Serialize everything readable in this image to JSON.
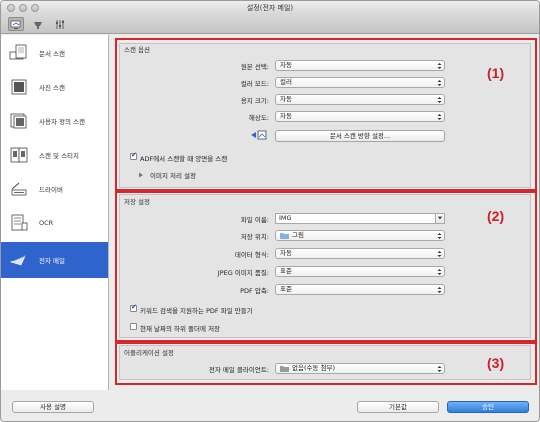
{
  "window": {
    "title": "설정(전자 메일)"
  },
  "sidebar": {
    "items": [
      {
        "label": "문서 스캔",
        "icon": "document-scan-icon"
      },
      {
        "label": "사진 스캔",
        "icon": "photo-scan-icon"
      },
      {
        "label": "사용자 정의 스캔",
        "icon": "custom-scan-icon"
      },
      {
        "label": "스캔 및 스티치",
        "icon": "scan-stitch-icon"
      },
      {
        "label": "드라이버",
        "icon": "driver-icon"
      },
      {
        "label": "OCR",
        "icon": "ocr-icon"
      },
      {
        "label": "전자 메일",
        "icon": "email-icon"
      }
    ],
    "selected_index": 6
  },
  "scan_options": {
    "title": "스캔 옵션",
    "source_label": "원본 선택:",
    "source_value": "자동",
    "color_mode_label": "컬러 모드:",
    "color_mode_value": "컬러",
    "paper_size_label": "용지 크기:",
    "paper_size_value": "자동",
    "resolution_label": "해상도:",
    "resolution_value": "자동",
    "orientation_button": "문서 스캔 방향 설정...",
    "adf_duplex_label": "ADF에서 스캔할 때 양면을 스캔",
    "adf_duplex_checked": true,
    "image_processing_label": "이미지 처리 설정"
  },
  "save_settings": {
    "title": "저장 설정",
    "filename_label": "파일 이름:",
    "filename_value": "IMG",
    "save_in_label": "저장 위치:",
    "save_in_value": "그림",
    "data_format_label": "데이터 형식:",
    "data_format_value": "자동",
    "jpeg_quality_label": "JPEG 이미지 품질:",
    "jpeg_quality_value": "표준",
    "pdf_compression_label": "PDF 압축:",
    "pdf_compression_value": "표준",
    "keyword_pdf_label": "키워드 검색을 지원하는 PDF 파일 만들기",
    "keyword_pdf_checked": true,
    "subfolder_label": "현재 날짜의 하위 폴더에 저장",
    "subfolder_checked": false
  },
  "app_settings": {
    "title": "어플리케이션 설정",
    "email_client_label": "전자 메일 클라이언트:",
    "email_client_value": "없음(수동 첨부)"
  },
  "callouts": {
    "one": "(1)",
    "two": "(2)",
    "three": "(3)"
  },
  "footer": {
    "instructions": "사용 설명",
    "defaults": "기본값",
    "ok": "승인"
  },
  "colors": {
    "accent": "#2f64cc",
    "callout_red": "#d8272c",
    "ok_blue": "#2f7fe0"
  }
}
